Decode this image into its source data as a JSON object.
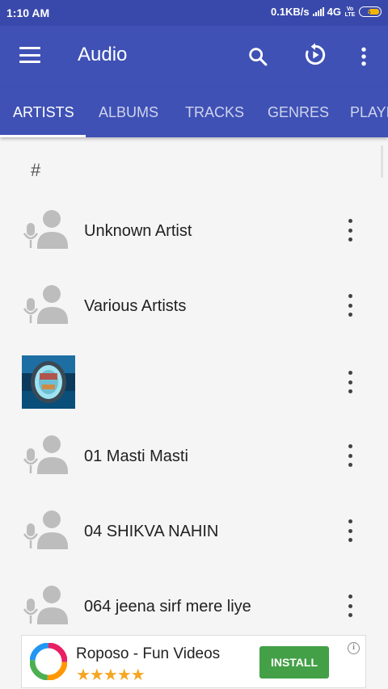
{
  "status_bar": {
    "time": "1:10 AM",
    "network_speed": "0.1KB/s",
    "network_type": "4G",
    "volte": "Vo LTE",
    "battery": "5"
  },
  "toolbar": {
    "title": "Audio",
    "icons": [
      "menu-icon",
      "search-icon",
      "resume-playback-icon",
      "more-vert-icon"
    ]
  },
  "tabs": [
    "ARTISTS",
    "ALBUMS",
    "TRACKS",
    "GENRES",
    "PLAYLISTS"
  ],
  "active_tab": "ARTISTS",
  "section_header": "#",
  "artists": [
    {
      "name": "Unknown Artist",
      "has_artwork": false
    },
    {
      "name": "Various Artists",
      "has_artwork": false
    },
    {
      "name": "",
      "has_artwork": true
    },
    {
      "name": "01 Masti Masti",
      "has_artwork": false
    },
    {
      "name": "04 SHIKVA NAHIN",
      "has_artwork": false
    },
    {
      "name": "064 jeena sirf mere liye",
      "has_artwork": false
    }
  ],
  "ad": {
    "app_name": "Roposo - Fun Videos",
    "rating": 4.5,
    "stars": "★★★★★",
    "install_label": "INSTALL",
    "info": "i",
    "install_color": "#43a047"
  },
  "colors": {
    "primary": "#3f51b5",
    "status_bar": "#3949ab",
    "background": "#f5f5f5"
  }
}
